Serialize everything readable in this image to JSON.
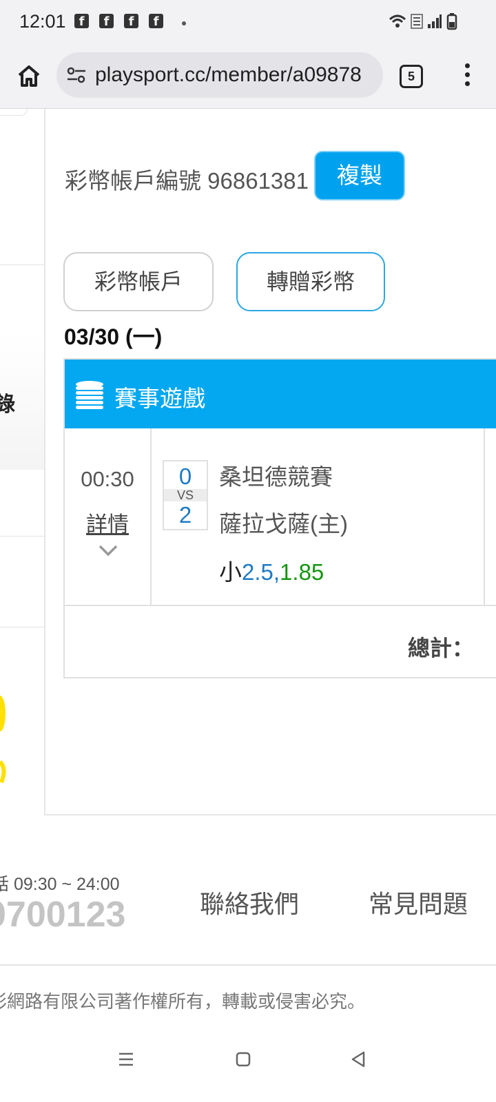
{
  "status_bar": {
    "time": "12:01",
    "notification_icons": [
      "facebook-icon",
      "facebook-icon",
      "facebook-icon",
      "facebook-icon"
    ],
    "fb_glyph": "f",
    "right_icons": [
      "wifi-icon",
      "volte-icon",
      "signal-icon",
      "battery-icon"
    ]
  },
  "browser": {
    "url": "playsport.cc/member/a09878",
    "tab_count": "5"
  },
  "sidebar": {
    "partial_label": "錄"
  },
  "account": {
    "label": "彩幣帳戶編號 96861381",
    "copy_button": "複製"
  },
  "tabs": [
    {
      "label": "彩幣帳戶"
    },
    {
      "label": "轉贈彩幣"
    }
  ],
  "date_heading": "03/30 (一)",
  "game_card": {
    "title": "賽事遊戲",
    "time": "00:30",
    "detail_link": "詳情",
    "score_a": "0",
    "vs": "VS",
    "score_b": "2",
    "team_a": "桑坦德競賽",
    "team_b": "薩拉戈薩(主)",
    "pick_direction": "小",
    "pick_line": "2.5",
    "pick_comma": ",",
    "pick_odds": "1.85",
    "total_label": "總計："
  },
  "footer": {
    "hours": "話 09:30 ~ 24:00",
    "phone": "0700123",
    "contact_link": "聯絡我們",
    "faq_link": "常見問題",
    "copyright": "彩網路有限公司著作權所有，轉載或侵害必究。"
  },
  "colors": {
    "accent": "#03a8f0",
    "score_blue": "#1f7ac4",
    "odds_green": "#14960f"
  }
}
